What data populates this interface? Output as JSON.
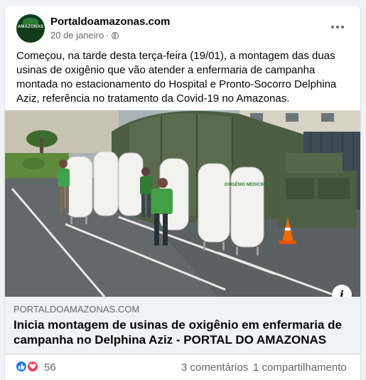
{
  "post": {
    "page_name": "Portaldoamazonas.com",
    "avatar_text": "AMAZONAS",
    "date": "20 de janeiro",
    "separator": "·",
    "privacy_icon": "globe-icon",
    "more_icon": "more-horizontal-icon",
    "text": "Começou, na tarde desta terça-feira (19/01), a montagem das duas usinas de oxigênio que vão atender a enfermaria de campanha montada no estacionamento do Hospital e Pronto-Socorro Delphina Aziz, referência no tratamento da Covid-19 no Amazonas."
  },
  "photo": {
    "tank_label": "OXIGÊNIO MEDICINAL",
    "info_icon": "info-icon",
    "info_label": "i"
  },
  "link": {
    "domain": "PORTALDOAMAZONAS.COM",
    "title": "Inicia montagem de usinas de oxigênio em enfermaria de campanha no Delphina Aziz - PORTAL DO AMAZONAS"
  },
  "footer": {
    "reaction_icons": [
      "like-icon",
      "love-icon"
    ],
    "reactions_count": "56",
    "comments": "3 comentários",
    "shares": "1 compartilhamento"
  },
  "colors": {
    "background": "#f0f2f5",
    "card": "#ffffff",
    "secondary_text": "#65676b",
    "like_blue": "#1877f2",
    "love_red": "#f33e58"
  }
}
